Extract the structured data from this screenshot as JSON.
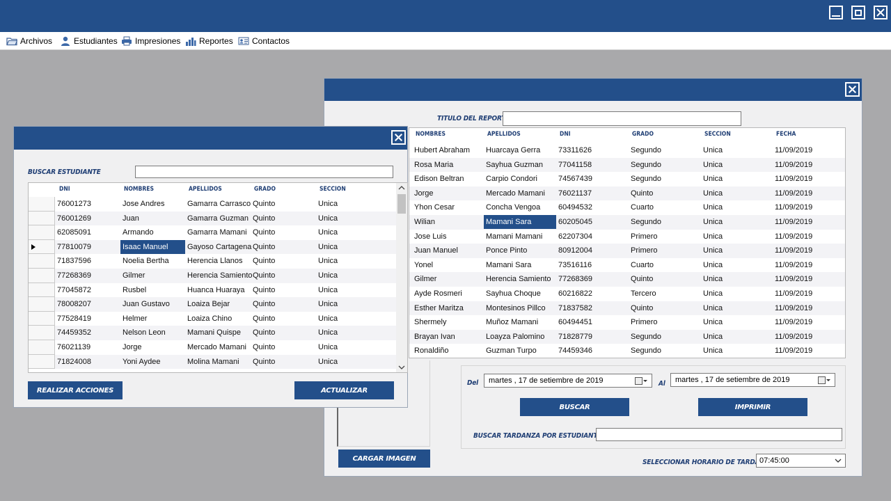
{
  "menu": {
    "items": [
      {
        "label": "Archivos",
        "icon": "folder-icon"
      },
      {
        "label": "Estudiantes",
        "icon": "user-icon"
      },
      {
        "label": "Impresiones",
        "icon": "printer-icon"
      },
      {
        "label": "Reportes",
        "icon": "bar-chart-icon"
      },
      {
        "label": "Contactos",
        "icon": "contact-card-icon"
      }
    ]
  },
  "students_dialog": {
    "search_label": "BUSCAR ESTUDIANTE",
    "search_value": "",
    "columns": [
      "DNI",
      "NOMBRES",
      "APELLIDOS",
      "GRADO",
      "SECCION"
    ],
    "rows": [
      [
        "76001273",
        "Jose Andres",
        "Gamarra Carrasco",
        "Quinto",
        "Unica"
      ],
      [
        "76001269",
        "Juan",
        "Gamarra Guzman",
        "Quinto",
        "Unica"
      ],
      [
        "62085091",
        "Armando",
        "Gamarra Mamani",
        "Quinto",
        "Unica"
      ],
      [
        "77810079",
        "Isaac Manuel",
        "Gayoso Cartagena",
        "Quinto",
        "Unica"
      ],
      [
        "71837596",
        "Noelia Bertha",
        "Herencia Llanos",
        "Quinto",
        "Unica"
      ],
      [
        "77268369",
        "Gilmer",
        "Herencia Samiento",
        "Quinto",
        "Unica"
      ],
      [
        "77045872",
        "Rusbel",
        "Huanca Huaraya",
        "Quinto",
        "Unica"
      ],
      [
        "78008207",
        "Juan Gustavo",
        "Loaiza Bejar",
        "Quinto",
        "Unica"
      ],
      [
        "77528419",
        "Helmer",
        "Loaiza Chino",
        "Quinto",
        "Unica"
      ],
      [
        "74459352",
        "Nelson Leon",
        "Mamani Quispe",
        "Quinto",
        "Unica"
      ],
      [
        "76021139",
        "Jorge",
        "Mercado Mamani",
        "Quinto",
        "Unica"
      ],
      [
        "71824008",
        "Yoni Aydee",
        "Molina Mamani",
        "Quinto",
        "Unica"
      ]
    ],
    "selected_row": 3,
    "btn_actions": "REALIZAR ACCIONES",
    "btn_update": "ACTUALIZAR"
  },
  "report_dialog": {
    "title_label": "TITULO DEL REPORTE",
    "title_value": "",
    "columns": [
      "NOMBRES",
      "APELLIDOS",
      "DNI",
      "GRADO",
      "SECCION",
      "FECHA"
    ],
    "rows": [
      [
        "Hubert Abraham",
        "Huarcaya Gerra",
        "73311626",
        "Segundo",
        "Unica",
        "11/09/2019"
      ],
      [
        "Rosa Maria",
        "Sayhua Guzman",
        "77041158",
        "Segundo",
        "Unica",
        "11/09/2019"
      ],
      [
        "Edison Beltran",
        "Carpio Condori",
        "74567439",
        "Segundo",
        "Unica",
        "11/09/2019"
      ],
      [
        "Jorge",
        "Mercado Mamani",
        "76021137",
        "Quinto",
        "Unica",
        "11/09/2019"
      ],
      [
        "Yhon Cesar",
        "Concha Vengoa",
        "60494532",
        "Cuarto",
        "Unica",
        "11/09/2019"
      ],
      [
        "Wilian",
        "Mamani Sara",
        "60205045",
        "Segundo",
        "Unica",
        "11/09/2019"
      ],
      [
        "Jose Luis",
        "Mamani Mamani",
        "62207304",
        "Primero",
        "Unica",
        "11/09/2019"
      ],
      [
        "Juan Manuel",
        "Ponce Pinto",
        "80912004",
        "Primero",
        "Unica",
        "11/09/2019"
      ],
      [
        "Yonel",
        "Mamani Sara",
        "73516116",
        "Cuarto",
        "Unica",
        "11/09/2019"
      ],
      [
        "Gilmer",
        "Herencia Samiento",
        "77268369",
        "Quinto",
        "Unica",
        "11/09/2019"
      ],
      [
        "Ayde Rosmeri",
        "Sayhua Choque",
        "60216822",
        "Tercero",
        "Unica",
        "11/09/2019"
      ],
      [
        "Esther Maritza",
        "Montesinos Pillco",
        "71837582",
        "Quinto",
        "Unica",
        "11/09/2019"
      ],
      [
        "Shermely",
        "Muñoz Mamani",
        "60494451",
        "Primero",
        "Unica",
        "11/09/2019"
      ],
      [
        "Brayan Ivan",
        "Loayza Palomino",
        "71828779",
        "Segundo",
        "Unica",
        "11/09/2019"
      ],
      [
        "Ronaldiño",
        "Guzman Turpo",
        "74459346",
        "Segundo",
        "Unica",
        "11/09/2019"
      ]
    ],
    "selected_row": 5,
    "from_label": "Del",
    "to_label": "Al",
    "from_date": "martes   , 17 de  setiembre  de  2019",
    "to_date": "martes   , 17 de  setiembre  de  2019",
    "btn_search": "BUSCAR",
    "btn_print": "IMPRIMIR",
    "late_label": "BUSCAR TARDANZA POR ESTUDIANTE",
    "late_value": "",
    "btn_load_image": "CARGAR IMAGEN",
    "schedule_label": "SELECCIONAR HORARIO DE TARDANZA",
    "schedule_value": "07:45:00"
  },
  "colors": {
    "accent": "#234f8a",
    "background": "#a9a9ab"
  }
}
